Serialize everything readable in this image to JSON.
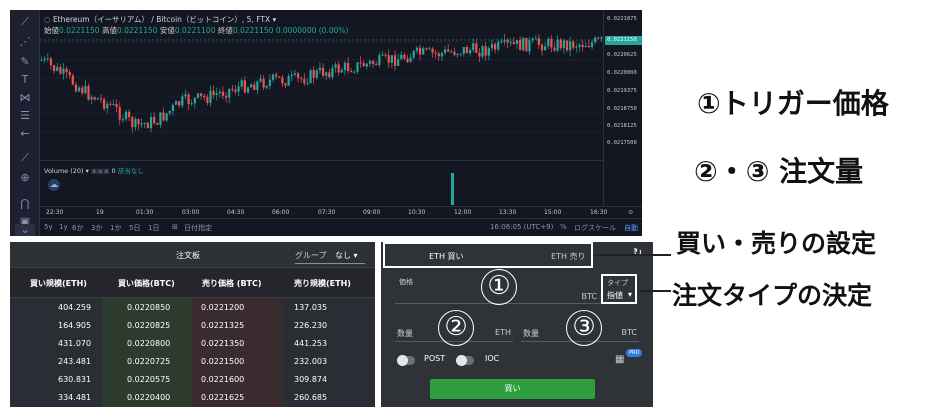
{
  "chart": {
    "legend_title": "Ethereum（イーサリアム） / Bitcoin（ビットコイン）, 5, FTX",
    "legend_open_label": "始値",
    "legend_open": "0.0221150",
    "legend_high_label": "高値",
    "legend_high": "0.0221150",
    "legend_low_label": "安値",
    "legend_low": "0.0221100",
    "legend_close_label": "終値",
    "legend_close": "0.0221150",
    "legend_change": "0.0000000 (0.00%)",
    "current_price": "0.0221150",
    "price_labels": [
      "0.0221875",
      "0.0220625",
      "0.0220000",
      "0.0219375",
      "0.0218750",
      "0.0218125",
      "0.0217500"
    ],
    "volume_label": "Volume (20)",
    "volume_value": "0",
    "volume_extra": "該当なし",
    "time_labels": [
      "22:30",
      "19",
      "01:30",
      "03:00",
      "04:30",
      "06:00",
      "07:30",
      "09:00",
      "10:30",
      "12:00",
      "13:30",
      "15:00",
      "16:30"
    ],
    "range_buttons": [
      "5y",
      "1y",
      "6か",
      "3か",
      "1か",
      "5日",
      "1日"
    ],
    "range_extra": "日付指定",
    "clock": "16:06:05 (UTC+9)",
    "percent_label": "%",
    "log_label": "ログスケール",
    "auto_label": "自動"
  },
  "orderbook": {
    "title": "注文板",
    "group_label": "グループ",
    "group_value": "なし",
    "columns": [
      "買い規模(ETH)",
      "買い価格(BTC)",
      "売り価格 (BTC)",
      "売り規模(ETH)"
    ],
    "rows": [
      [
        "404.259",
        "0.0220850",
        "0.0221200",
        "137.035"
      ],
      [
        "164.905",
        "0.0220825",
        "0.0221325",
        "226.230"
      ],
      [
        "431.070",
        "0.0220800",
        "0.0221350",
        "441.253"
      ],
      [
        "243.481",
        "0.0220725",
        "0.0221500",
        "232.003"
      ],
      [
        "630.831",
        "0.0220575",
        "0.0221600",
        "309.874"
      ],
      [
        "334.481",
        "0.0220400",
        "0.0221625",
        "260.685"
      ]
    ]
  },
  "order_form": {
    "tab_buy": "ETH 買い",
    "tab_sell": "ETH 売り",
    "price_label": "価格",
    "price_unit": "BTC",
    "type_label": "タイプ",
    "type_value": "指値",
    "qty_label_1": "数量",
    "qty_unit_1": "ETH",
    "qty_label_2": "数量",
    "qty_unit_2": "BTC",
    "post_label": "POST",
    "ioc_label": "IOC",
    "pro_badge": "PRO",
    "submit_label": "買い"
  },
  "annotations": {
    "circled_1": "①",
    "circled_2": "②",
    "circled_3": "③",
    "trigger_price": "①トリガー価格",
    "quantity": "②・③ 注文量",
    "buy_sell_setting": "買い・売りの設定",
    "order_type_decision": "注文タイプの決定"
  },
  "colors": {
    "up": "#26a69a",
    "down": "#ef5350",
    "buy_button": "#2e9e3e",
    "price_tag": "#26a69a"
  }
}
